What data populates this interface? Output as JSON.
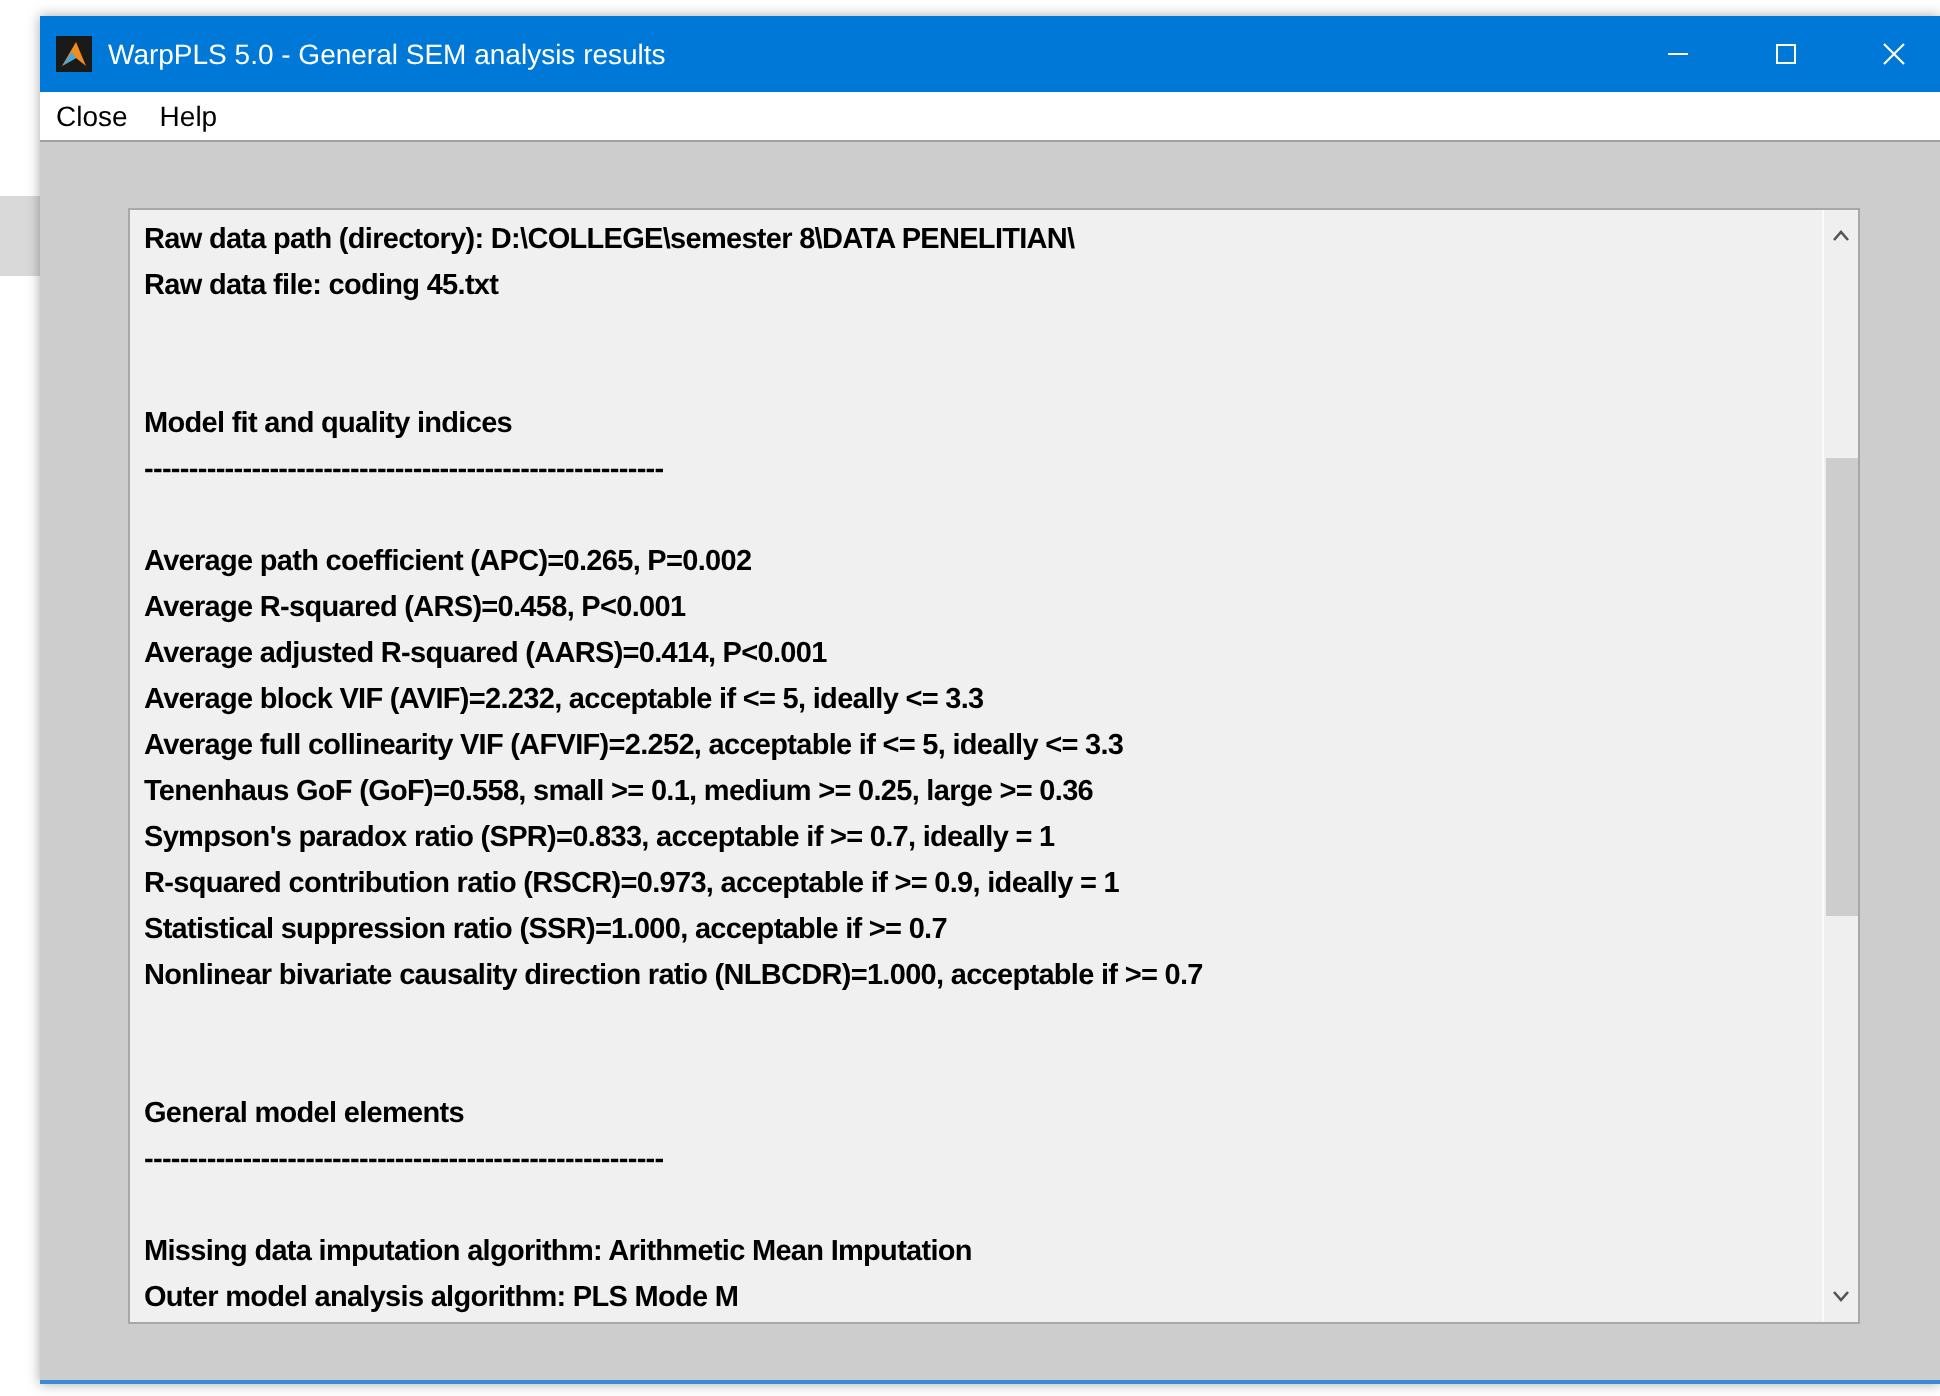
{
  "window": {
    "title": "WarpPLS 5.0 - General SEM analysis results"
  },
  "menu": [
    "Close",
    "Help"
  ],
  "output_lines": [
    {
      "kind": "text",
      "text": "Raw data path (directory): D:\\COLLEGE\\semester 8\\DATA PENELITIAN\\"
    },
    {
      "kind": "text",
      "text": "Raw data file: coding 45.txt"
    },
    {
      "kind": "blank"
    },
    {
      "kind": "blank"
    },
    {
      "kind": "text",
      "text": "Model fit and quality indices"
    },
    {
      "kind": "text",
      "text": "----------------------------------------------------------"
    },
    {
      "kind": "blank"
    },
    {
      "kind": "text",
      "text": "Average path coefficient (APC)=0.265, P=0.002"
    },
    {
      "kind": "text",
      "text": "Average R-squared (ARS)=0.458, P<0.001"
    },
    {
      "kind": "text",
      "text": "Average adjusted R-squared (AARS)=0.414, P<0.001"
    },
    {
      "kind": "text",
      "text": "Average block VIF (AVIF)=2.232, acceptable if <= 5, ideally <= 3.3"
    },
    {
      "kind": "text",
      "text": "Average full collinearity VIF (AFVIF)=2.252, acceptable if <= 5, ideally <= 3.3"
    },
    {
      "kind": "text",
      "text": "Tenenhaus GoF (GoF)=0.558, small >= 0.1, medium >= 0.25, large >= 0.36"
    },
    {
      "kind": "text",
      "text": "Sympson's paradox ratio (SPR)=0.833, acceptable if >= 0.7, ideally = 1"
    },
    {
      "kind": "text",
      "text": "R-squared contribution ratio (RSCR)=0.973, acceptable if >= 0.9, ideally = 1"
    },
    {
      "kind": "text",
      "text": "Statistical suppression ratio (SSR)=1.000, acceptable if >= 0.7"
    },
    {
      "kind": "text",
      "text": "Nonlinear bivariate causality direction ratio (NLBCDR)=1.000, acceptable if >= 0.7"
    },
    {
      "kind": "blank"
    },
    {
      "kind": "blank"
    },
    {
      "kind": "text",
      "text": "General model elements"
    },
    {
      "kind": "text",
      "text": "----------------------------------------------------------"
    },
    {
      "kind": "blank"
    },
    {
      "kind": "text",
      "text": "Missing data imputation algorithm: Arithmetic Mean Imputation"
    },
    {
      "kind": "text",
      "text": "Outer model analysis algorithm: PLS Mode M"
    }
  ]
}
